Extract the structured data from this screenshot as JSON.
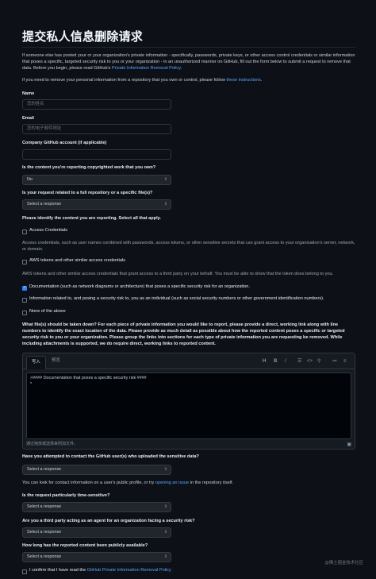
{
  "page": {
    "title": "提交私人信息删除请求",
    "intro_1_pre": "If someone else has posted your or your organization's private information - specifically, passwords, private keys, or other access control credentials or similar information that poses a specific, targeted security risk to you or your organization - in an unauthorized manner on GitHub, fill out the form below to submit a request to remove that data. Before you begin, please read GitHub's ",
    "intro_1_link": "Private Information Removal Policy",
    "intro_1_post": ".",
    "intro_2_pre": "If you need to remove your personal information from a repository that you own or control, please follow ",
    "intro_2_link": "these instructions",
    "intro_2_post": "."
  },
  "form": {
    "name_label": "Name",
    "name_placeholder": "您的姓名",
    "email_label": "Email",
    "email_placeholder": "您的电子邮件地址",
    "company_label": "Company GitHub account (if applicable)",
    "copyright_label": "Is the content you're reporting copyrighted work that you own?",
    "copyright_value": "No",
    "repo_label": "Is your request related to a full repository or a specific file(s)?",
    "repo_value": "Select a response",
    "identify_label": "Please identify the content you are reporting. Select all that apply.",
    "cb1_label": "Access Credentials",
    "cb1_desc": "Access credentials, such as user names combined with passwords, access tokens, or other sensitive secrets that can grant access to your organization's server, network, or domain.",
    "cb2_label": "AWS tokens and other similar access credentials",
    "cb2_desc": "AWS tokens and other similar access credentials that grant access to a third party on your behalf. You must be able to show that the token does belong to you.",
    "cb3_label": "Documentation (such as network diagrams or architecture) that poses a specific security risk for an organization.",
    "cb4_label": "Information related to, and posing a security risk to, you as an individual (such as social security numbers or other government identification numbers).",
    "cb5_label": "None of the above",
    "files_label": "What file(s) should be taken down? For each piece of private information you would like to report, please provide a direct, working link along with line numbers to identify the exact location of the data. Please provide as much detail as possible about how the reported content poses a specific or targeted security risk to you or your organization. Please group the links into sections for each type of private information you are requesting be removed. While including attachments is supported, we do require direct, working links to reported content.",
    "editor": {
      "tab_write": "写入",
      "tab_preview": "预览",
      "content_line1": ">#### Documentation that poses a specific security risk ####",
      "content_line2": "*",
      "footer": "通过拖放或选择来附加文件。"
    },
    "contact_label": "Have you attempted to contact the GitHub user(s) who uploaded the sensitive data?",
    "contact_value": "Select a response",
    "contact_note_pre": "You can look for contact information on a user's public profile, or try ",
    "contact_note_link": "opening an issue",
    "contact_note_post": " in the repository itself.",
    "time_label": "Is the request particularly time-sensitive?",
    "time_value": "Select a response",
    "agent_label": "Are you a third party acting as an agent for an organization facing a security risk?",
    "agent_value": "Select a response",
    "howlong_label": "How long has the reported content been publicly available?",
    "howlong_value": "Select a response",
    "confirm_pre": "I confirm that I have read the ",
    "confirm_link": "GitHub Private Information Removal Policy"
  },
  "watermark": "@稀土掘金技术社区"
}
